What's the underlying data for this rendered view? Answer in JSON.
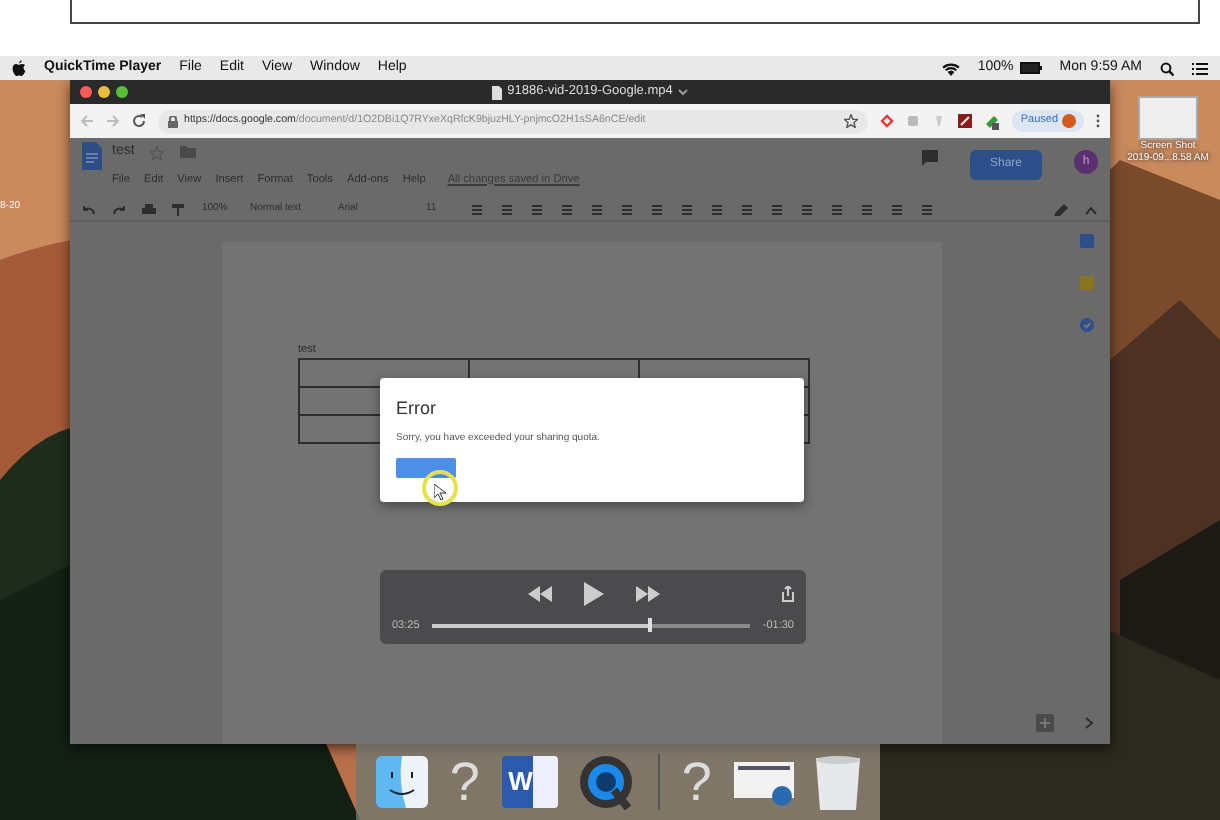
{
  "menu_bar": {
    "app": "QuickTime Player",
    "menus": [
      "File",
      "Edit",
      "View",
      "Window",
      "Help"
    ],
    "battery": "100%",
    "clock": "Mon 9:59 AM"
  },
  "desktop": {
    "edge_label": "8-20",
    "icons": [
      {
        "label_lines": [
          "Screen Shot",
          "2019-09...8.58 AM"
        ]
      }
    ]
  },
  "player_window": {
    "title": "91886-vid-2019-Google.mp4",
    "browser": {
      "url_host": "https://docs.google.com",
      "url_path": "/document/d/1O2DBi1Q7RYxeXqRfcK9bjuzHLY-pnjmcO2H1sSA6nCE/edit",
      "profile_status": "Paused"
    },
    "document": {
      "title": "test",
      "menus": [
        "File",
        "Edit",
        "View",
        "Insert",
        "Format",
        "Tools",
        "Add-ons",
        "Help"
      ],
      "save_status": "All changes saved in Drive",
      "zoom": "100%",
      "style": "Normal text",
      "font": "Arial",
      "size": "11",
      "share": "Share",
      "avatar": "h",
      "body_text": "test"
    },
    "dialog": {
      "title": "Error",
      "message": "Sorry, you have exceeded your sharing quota."
    },
    "controls": {
      "playing": false,
      "elapsed": "03:25",
      "remaining": "-01:30",
      "level": 0.68
    }
  },
  "dock": {
    "items": [
      {
        "kind": "finder"
      },
      {
        "kind": "unknown",
        "glyph": "?"
      },
      {
        "kind": "word",
        "letter": "W"
      },
      {
        "kind": "quicktime"
      },
      {
        "kind": "separator"
      },
      {
        "kind": "unknown",
        "glyph": "?"
      },
      {
        "kind": "screenshot"
      },
      {
        "kind": "trash"
      }
    ]
  }
}
